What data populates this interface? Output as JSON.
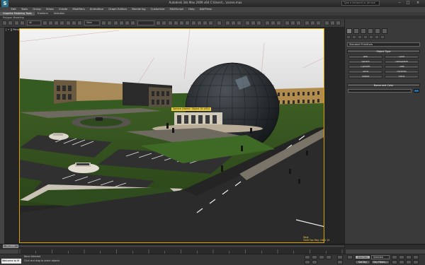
{
  "window": {
    "app_icon": "3ds-max-logo-icon",
    "app_logo_text": "S",
    "title": "Autodesk 3ds Max 2009 x64    C:\\Users\\...\\scene.max",
    "search_placeholder": "Type a keyword or phrase",
    "minimize_glyph": "‒",
    "maximize_glyph": "□",
    "close_glyph": "×"
  },
  "menu": [
    "Edit",
    "Tools",
    "Group",
    "Views",
    "Create",
    "Modifiers",
    "Animation",
    "Graph Editors",
    "Rendering",
    "Customize",
    "MAXScript",
    "Help",
    "DAEPrest"
  ],
  "ribbon": {
    "tabs": [
      "Graphite Modeling Tools",
      "Freeform",
      "Selection"
    ],
    "active_tab": 0,
    "subpanel": "Polygon Modeling"
  },
  "toolbar": {
    "selection_filter": "All",
    "view_dropdown": "View"
  },
  "viewport": {
    "label": "[ + ][ Perspective ][ Smooth + Highlights ]",
    "tooltip": "Sphere (Name: Object 01 (fill))",
    "fps_line1": "Total",
    "fps_line2": "3445 Fps  Poly: 2482    15"
  },
  "command_panel": {
    "category_dropdown": "Standard Primitives",
    "rollout_object_type": "Object Type",
    "autogrid_label": "AutoGrid",
    "object_buttons": [
      "Box",
      "Cone",
      "Sphere",
      "GeoSphere",
      "Cylinder",
      "Tube",
      "Torus",
      "Pyramid",
      "Teapot",
      "Plane"
    ],
    "rollout_name_color": "Name and Color",
    "swatch_color": "#1a6fb0"
  },
  "timeline": {
    "position_label": "0 / 100"
  },
  "statusbar": {
    "maxscript_text": "Welcome to M",
    "status_top": "None Selected",
    "status_bottom": "Click and drag to select objects",
    "autokey_label": "Auto Key",
    "selected_label": "Selected",
    "setkey_label": "Set Key",
    "keyfilters_label": "Key Filters..."
  },
  "colors": {
    "viewport_border": "#d8a000",
    "accent": "#e9cc43"
  }
}
